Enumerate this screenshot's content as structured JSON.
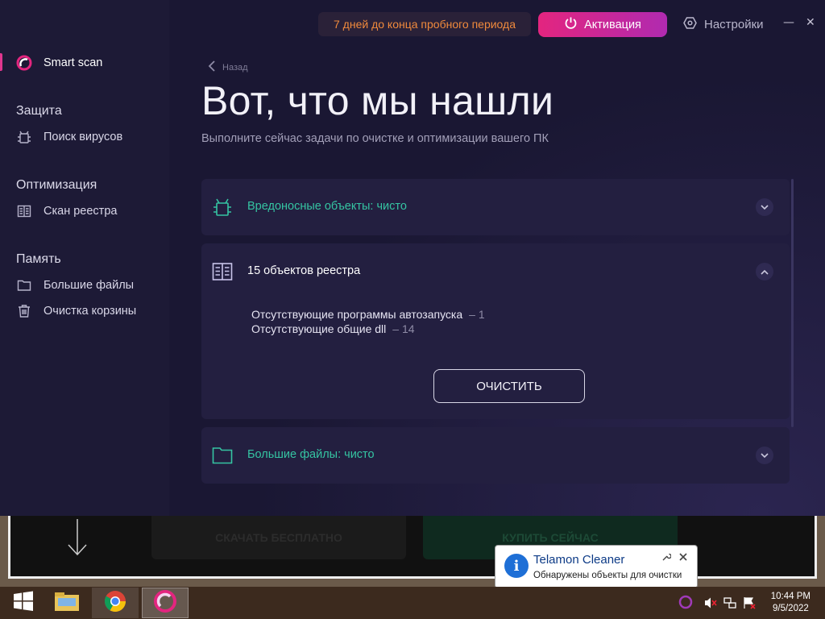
{
  "topbar": {
    "trial_text": "7 дней до конца пробного периода",
    "activate_label": "Активация",
    "settings_label": "Настройки",
    "minimize": "—",
    "close": "✕"
  },
  "sidebar": {
    "smart_scan": "Smart scan",
    "sections": [
      {
        "heading": "Защита",
        "items": [
          {
            "label": "Поиск вирусов",
            "icon": "bug-icon"
          }
        ]
      },
      {
        "heading": "Оптимизация",
        "items": [
          {
            "label": "Скан реестра",
            "icon": "registry-book-icon"
          }
        ]
      },
      {
        "heading": "Память",
        "items": [
          {
            "label": "Большие файлы",
            "icon": "folder-icon"
          },
          {
            "label": "Очистка корзины",
            "icon": "trash-icon"
          }
        ]
      }
    ]
  },
  "main": {
    "back_label": "Назад",
    "title": "Вот, что мы нашли",
    "subtitle": "Выполните сейчас задачи по очистке и оптимизации вашего ПК",
    "cards": {
      "malware": {
        "title": "Вредоносные объекты: чисто"
      },
      "registry": {
        "title": "15 объектов реестра",
        "details": [
          {
            "label": "Отсутствующие программы автозапуска",
            "count": "– 1"
          },
          {
            "label": "Отсутствующие общие dll",
            "count": "– 14"
          }
        ],
        "clean_button": "ОЧИСТИТЬ"
      },
      "files": {
        "title": "Большие файлы: чисто"
      }
    }
  },
  "background_web": {
    "download_button": "СКАЧАТЬ БЕСПЛАТНО",
    "buy_button": "КУПИТЬ СЕЙЧАС"
  },
  "notification": {
    "title": "Telamon Cleaner",
    "message": "Обнаружены объекты для очистки"
  },
  "taskbar": {
    "time": "10:44 PM",
    "date": "9/5/2022"
  },
  "colors": {
    "accent_pink": "#e3257f",
    "clean_green": "#35c4a2",
    "trial_orange": "#f08a3c"
  }
}
